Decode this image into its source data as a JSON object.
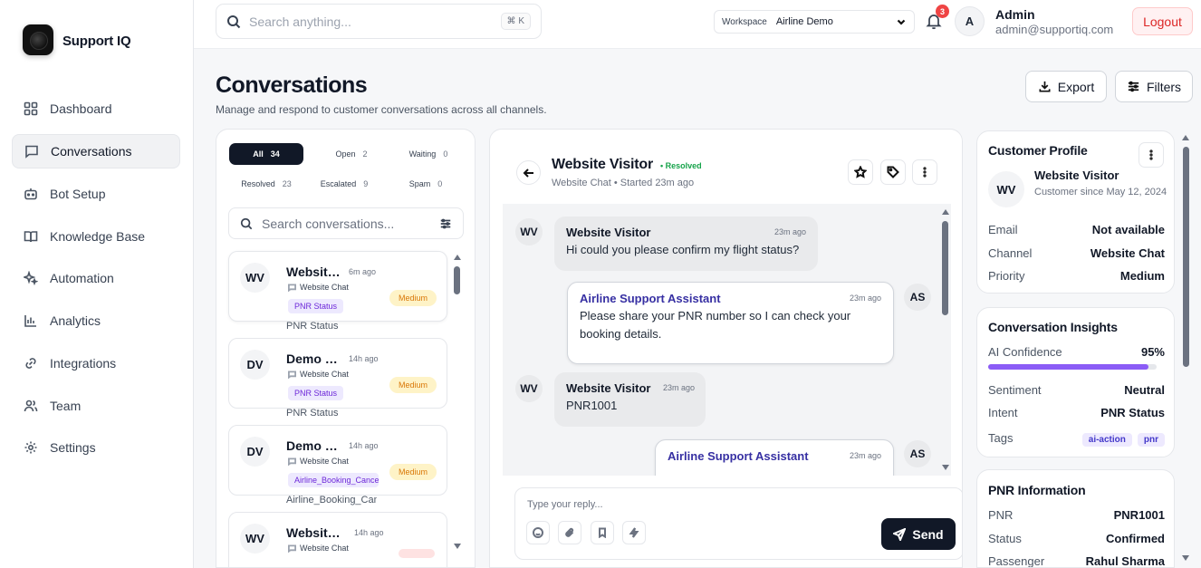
{
  "brand": {
    "name": "Support IQ"
  },
  "nav": [
    {
      "label": "Dashboard",
      "icon": "grid-icon"
    },
    {
      "label": "Conversations",
      "icon": "chat-icon",
      "active": true
    },
    {
      "label": "Bot Setup",
      "icon": "bot-icon"
    },
    {
      "label": "Knowledge Base",
      "icon": "book-icon"
    },
    {
      "label": "Automation",
      "icon": "sparkles-icon"
    },
    {
      "label": "Analytics",
      "icon": "bar-chart-icon"
    },
    {
      "label": "Integrations",
      "icon": "link-icon"
    },
    {
      "label": "Team",
      "icon": "users-icon"
    },
    {
      "label": "Settings",
      "icon": "gear-icon"
    }
  ],
  "topbar": {
    "search_placeholder": "Search anything...",
    "shortcut": "⌘ K",
    "workspace_label": "Workspace",
    "workspace_value": "Airline Demo",
    "notifications": "3",
    "avatar": "A",
    "admin_name": "Admin",
    "admin_email": "admin@supportiq.com",
    "logout": "Logout"
  },
  "page": {
    "title": "Conversations",
    "subtitle": "Manage and respond to customer conversations across all channels.",
    "export": "Export",
    "filters": "Filters"
  },
  "filters": [
    {
      "label": "All",
      "count": "34",
      "active": true
    },
    {
      "label": "Open",
      "count": "2"
    },
    {
      "label": "Waiting",
      "count": "0"
    },
    {
      "label": "Resolved",
      "count": "23"
    },
    {
      "label": "Escalated",
      "count": "9"
    },
    {
      "label": "Spam",
      "count": "0"
    }
  ],
  "list_search_placeholder": "Search conversations...",
  "conversations": [
    {
      "initials": "WV",
      "name": "Website Visitor",
      "time": "6m ago",
      "channel": "Website Chat",
      "tag": "PNR Status",
      "priority": "Medium",
      "preview": "PNR Status"
    },
    {
      "initials": "DV",
      "name": "Demo Visitor",
      "time": "14h ago",
      "channel": "Website Chat",
      "tag": "PNR Status",
      "priority": "Medium",
      "preview": "PNR Status"
    },
    {
      "initials": "DV",
      "name": "Demo Visitor",
      "time": "14h ago",
      "channel": "Website Chat",
      "tag": "Airline_Booking_Cancel",
      "priority": "Medium",
      "preview": "Airline_Booking_Cancel"
    },
    {
      "initials": "WV",
      "name": "Website Visitor",
      "time": "14h ago",
      "channel": "Website Chat",
      "tag": "",
      "priority": "",
      "preview": ""
    }
  ],
  "chat": {
    "name": "Website Visitor",
    "status": "• Resolved",
    "subtitle": "Website Chat • Started 23m ago",
    "messages": [
      {
        "from": "user",
        "initials": "WV",
        "sender": "Website Visitor",
        "time": "23m ago",
        "text": "Hi could you please confirm my flight status?"
      },
      {
        "from": "bot",
        "initials": "AS",
        "sender": "Airline Support Assistant",
        "time": "23m ago",
        "text": "Please share your PNR number so I can check your booking details."
      },
      {
        "from": "user",
        "initials": "WV",
        "sender": "Website Visitor",
        "time": "23m ago",
        "text": "PNR1001"
      },
      {
        "from": "bot",
        "initials": "AS",
        "sender": "Airline Support Assistant",
        "time": "23m ago",
        "text": ""
      }
    ],
    "reply_placeholder": "Type your reply...",
    "send": "Send"
  },
  "profile": {
    "title": "Customer Profile",
    "initials": "WV",
    "name": "Website Visitor",
    "since": "Customer since May 12, 2024",
    "email_label": "Email",
    "email": "Not available",
    "channel_label": "Channel",
    "channel": "Website Chat",
    "priority_label": "Priority",
    "priority": "Medium"
  },
  "insights": {
    "title": "Conversation Insights",
    "confidence_label": "AI Confidence",
    "confidence": "95%",
    "confidence_value": 0.95,
    "sentiment_label": "Sentiment",
    "sentiment": "Neutral",
    "intent_label": "Intent",
    "intent": "PNR Status",
    "tags_label": "Tags",
    "tags": [
      "ai-action",
      "pnr"
    ]
  },
  "pnr": {
    "title": "PNR Information",
    "pnr_label": "PNR",
    "pnr": "PNR1001",
    "status_label": "Status",
    "status": "Confirmed",
    "passenger_label": "Passenger",
    "passenger": "Rahul Sharma"
  },
  "colors": {
    "accent": "#111827",
    "purple": "#8b5cf6",
    "danger": "#ef4444",
    "medium": "#d97706",
    "resolved": "#16a34a"
  }
}
